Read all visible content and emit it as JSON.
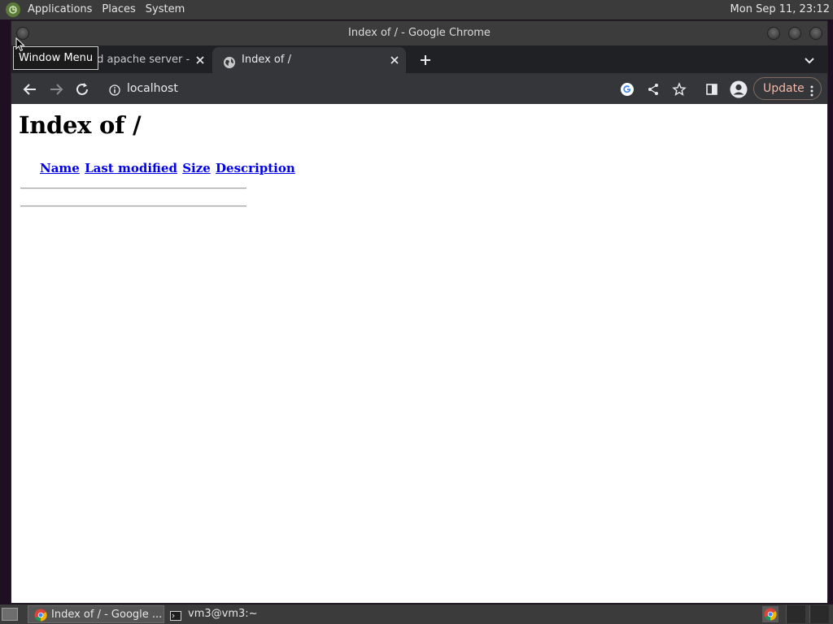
{
  "top_panel": {
    "menus": [
      "Applications",
      "Places",
      "System"
    ],
    "clock": "Mon Sep 11, 23:12"
  },
  "window": {
    "title": "Index of / - Google Chrome",
    "tooltip": "Window Menu"
  },
  "tabs": [
    {
      "label": "rd apache server - G",
      "active": false,
      "icon": "globe-icon"
    },
    {
      "label": "Index of /",
      "active": true,
      "icon": "globe-icon"
    }
  ],
  "toolbar": {
    "url": "localhost",
    "update_label": "Update"
  },
  "page": {
    "heading": "Index of /",
    "columns": [
      "Name",
      "Last modified",
      "Size",
      "Description"
    ]
  },
  "taskbar": {
    "items": [
      "Index of / - Google ...",
      "vm3@vm3:~"
    ]
  },
  "colors": {
    "panel": "#3b3b3b",
    "chrome_frame": "#202124",
    "chrome_toolbar": "#35363a",
    "link": "#0000ee",
    "update_text": "#f2b8a8"
  }
}
